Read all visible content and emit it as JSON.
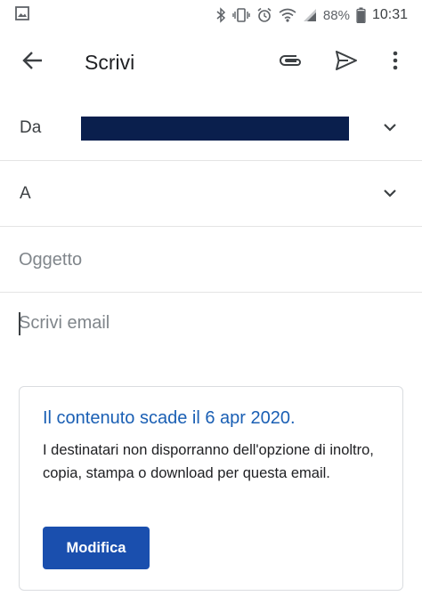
{
  "status_bar": {
    "battery": "88%",
    "time": "10:31",
    "icons": [
      "image-icon",
      "bluetooth-icon",
      "vibrate-icon",
      "alarm-icon",
      "wifi-icon",
      "signal-icon",
      "battery-icon"
    ]
  },
  "app_bar": {
    "title": "Scrivi",
    "icons": [
      "back-arrow-icon",
      "attach-icon",
      "send-icon",
      "more-vert-icon"
    ]
  },
  "compose": {
    "from_label": "Da",
    "from_value_redacted": true,
    "to_label": "A",
    "subject_placeholder": "Oggetto",
    "body_placeholder": "Scrivi email"
  },
  "info_card": {
    "title": "Il contenuto scade il 6 apr 2020.",
    "body": "I destinatari non disporranno dell'opzione di inoltro, copia, stampa o download per questa email.",
    "button_label": "Modifica"
  },
  "colors": {
    "accent": "#1a5fb4",
    "button": "#1a4fae",
    "redaction": "#0a1f4d",
    "divider": "#e4e4e4"
  }
}
